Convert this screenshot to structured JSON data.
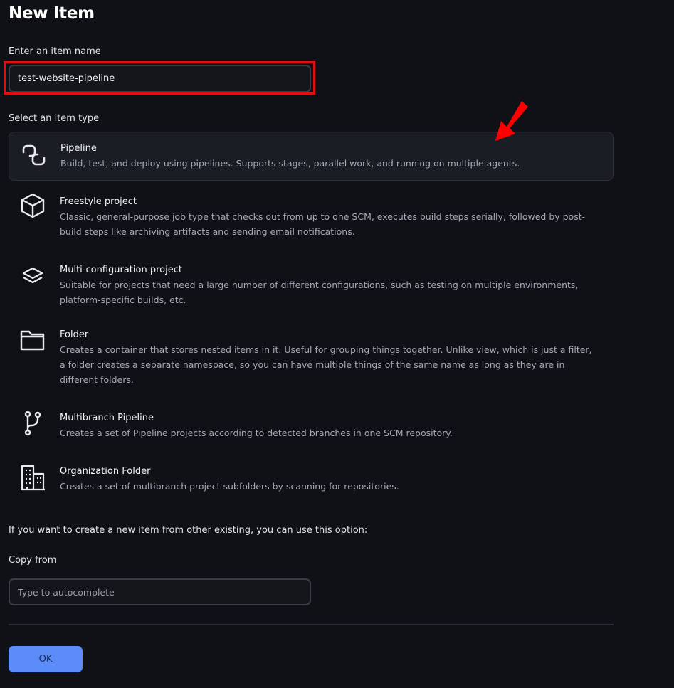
{
  "page": {
    "title": "New Item"
  },
  "name_field": {
    "label": "Enter an item name",
    "value": "test-website-pipeline"
  },
  "item_type": {
    "label": "Select an item type",
    "items": [
      {
        "name": "Pipeline",
        "icon": "pipeline-icon",
        "selected": true,
        "description": "Build, test, and deploy using pipelines. Supports stages, parallel work, and running on multiple agents."
      },
      {
        "name": "Freestyle project",
        "icon": "cube-icon",
        "selected": false,
        "description": "Classic, general-purpose job type that checks out from up to one SCM, executes build steps serially, followed by post-build steps like archiving artifacts and sending email notifications."
      },
      {
        "name": "Multi-configuration project",
        "icon": "layers-icon",
        "selected": false,
        "description": "Suitable for projects that need a large number of different configurations, such as testing on multiple environments, platform-specific builds, etc."
      },
      {
        "name": "Folder",
        "icon": "folder-icon",
        "selected": false,
        "description": "Creates a container that stores nested items in it. Useful for grouping things together. Unlike view, which is just a filter, a folder creates a separate namespace, so you can have multiple things of the same name as long as they are in different folders."
      },
      {
        "name": "Multibranch Pipeline",
        "icon": "git-branch-icon",
        "selected": false,
        "description": "Creates a set of Pipeline projects according to detected branches in one SCM repository."
      },
      {
        "name": "Organization Folder",
        "icon": "building-icon",
        "selected": false,
        "description": "Creates a set of multibranch project subfolders by scanning for repositories."
      }
    ]
  },
  "copy_section": {
    "hint": "If you want to create a new item from other existing, you can use this option:",
    "label": "Copy from",
    "placeholder": "Type to autocomplete"
  },
  "actions": {
    "ok_label": "OK"
  },
  "colors": {
    "background": "#101116",
    "selected_item": "#1b1d25",
    "highlight_box": "#e01010",
    "annotation_arrow": "#ff0000",
    "ok_button": "#5b8cf7"
  }
}
